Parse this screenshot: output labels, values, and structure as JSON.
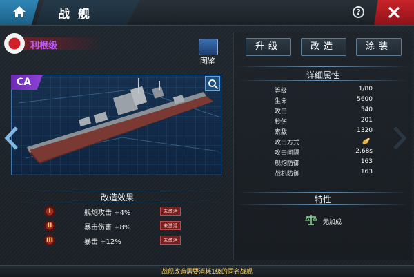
{
  "header": {
    "title": "战舰",
    "help_label": "?"
  },
  "ship": {
    "name": "利根级",
    "class_badge": "CA",
    "codex_label": "图鉴"
  },
  "tabs": [
    {
      "label": "升级"
    },
    {
      "label": "改造"
    },
    {
      "label": "涂装"
    }
  ],
  "details": {
    "heading": "详细属性",
    "stats": [
      {
        "label": "等级",
        "value": "1/80"
      },
      {
        "label": "生命",
        "value": "5600"
      },
      {
        "label": "攻击",
        "value": "540"
      },
      {
        "label": "秒伤",
        "value": "201"
      },
      {
        "label": "索敌",
        "value": "1320"
      },
      {
        "label": "攻击方式",
        "value": "",
        "icon": "shell-icon"
      },
      {
        "label": "攻击间隔",
        "value": "2.68s"
      },
      {
        "label": "舰炮防御",
        "value": "163"
      },
      {
        "label": "战机防御",
        "value": "163"
      }
    ]
  },
  "traits": {
    "heading": "特性",
    "text": "无加成",
    "icon": "scale-icon"
  },
  "modification": {
    "heading": "改造效果",
    "items": [
      {
        "rank": "I",
        "text": "舰炮攻击 +4%",
        "status": "未激活"
      },
      {
        "rank": "II",
        "text": "暴击伤害 +8%",
        "status": "未激活"
      },
      {
        "rank": "III",
        "text": "暴击 +12%",
        "status": "未激活"
      }
    ]
  },
  "footer": {
    "text": "战舰改造需要消耗1级的同名战舰"
  },
  "colors": {
    "accent_blue": "#2f86b6",
    "close_red": "#c8242b",
    "ship_name": "#c05cff",
    "badge_purple": "#8e42d8",
    "footer_text": "#ffd86a"
  }
}
